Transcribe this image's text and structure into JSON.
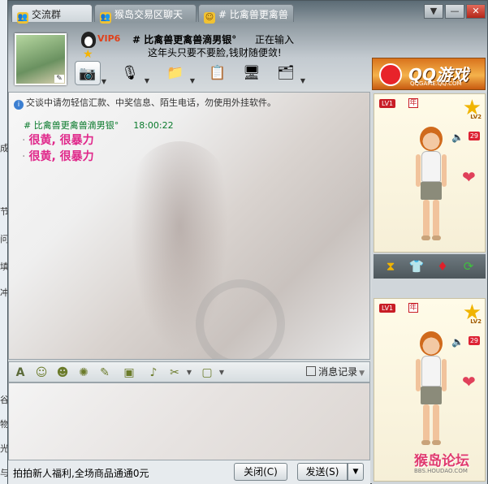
{
  "tabs": [
    {
      "label": "交流群",
      "icon": "group-icon",
      "active": true
    },
    {
      "label": "猴岛交易区聊天",
      "icon": "group-icon",
      "active": false
    },
    {
      "label": "# 比禽兽更禽兽",
      "icon": "smiley-icon",
      "active": false
    }
  ],
  "window_buttons": {
    "menu": "▼",
    "minimize": "—",
    "close": "✕"
  },
  "header": {
    "vip_label": "VIP6",
    "contact_name": "# 比禽兽更禽兽滴男银°",
    "status_text": "正在输入",
    "signature": "这年头只要不要脸,钱财随便敛!"
  },
  "ad": {
    "title": "QQ游戏",
    "subtitle": "QQGAME.QQ.COM"
  },
  "chat": {
    "notice": "交谈中请勿轻信汇款、中奖信息、陌生电话，勿使用外挂软件。",
    "message_header": {
      "sender": "# 比禽兽更禽兽滴男银°",
      "time": "18:00:22"
    },
    "messages": [
      "很黄, 很暴力",
      "很黄, 很暴力"
    ]
  },
  "input_toolbar": {
    "history_label": "消息记录"
  },
  "bottom": {
    "promo_text": "拍拍新人福利,全场商品通通0元",
    "close_button": "关闭(C)",
    "send_button": "发送(S)"
  },
  "show_panel": {
    "level_badge": "LV1",
    "year_badge": "年",
    "star_level": "LV2",
    "count_badge": "29"
  },
  "desktop_strip_chars": [
    "成",
    "节",
    "问",
    "填",
    "冲",
    "谷",
    "物",
    "光",
    "与"
  ],
  "watermark": {
    "text": "猴岛论坛",
    "url": "BBS.HOUDAO.COM"
  },
  "colors": {
    "message": "#e0278a",
    "sender": "#0a7a2c",
    "accent": "#c81d25"
  }
}
